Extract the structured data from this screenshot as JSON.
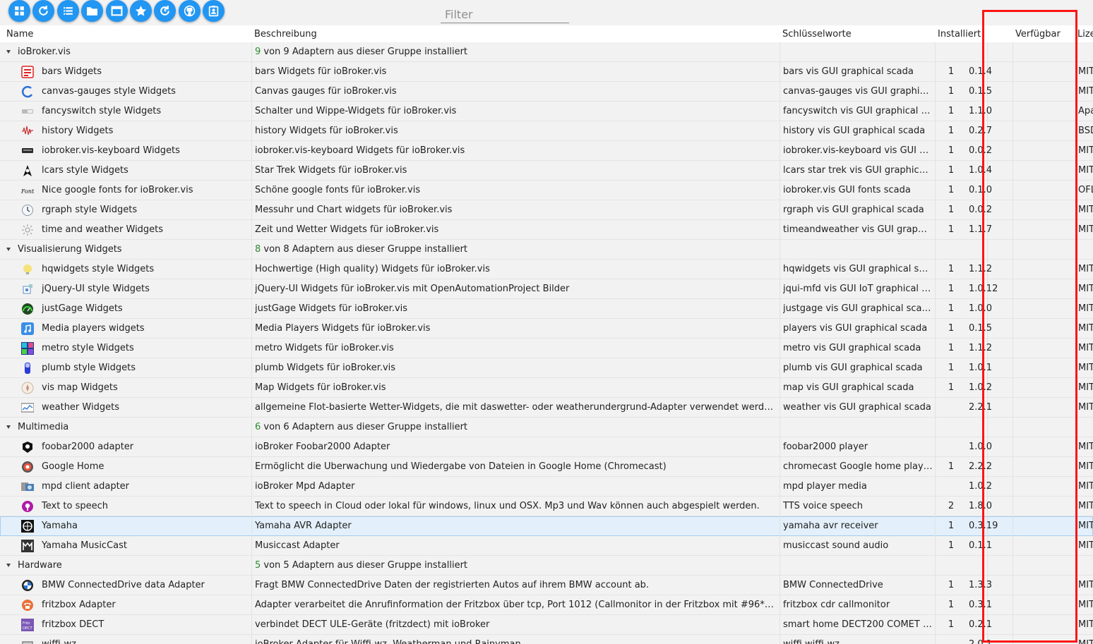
{
  "toolbar": {
    "buttons": [
      {
        "name": "view-tiles-button",
        "icon": "grid-icon"
      },
      {
        "name": "refresh-button",
        "icon": "refresh-icon"
      },
      {
        "name": "list-view-button",
        "icon": "list-icon"
      },
      {
        "name": "folder-button",
        "icon": "folder-icon"
      },
      {
        "name": "window-button",
        "icon": "window-icon"
      },
      {
        "name": "favorites-button",
        "icon": "star-icon"
      },
      {
        "name": "update-button",
        "icon": "update-icon"
      },
      {
        "name": "github-button",
        "icon": "github-icon"
      },
      {
        "name": "contacts-button",
        "icon": "badge-icon"
      }
    ],
    "filter_placeholder": "Filter"
  },
  "columns": {
    "name": "Name",
    "description": "Beschreibung",
    "keywords": "Schlüsselworte",
    "installed": "Installiert",
    "available": "Verfügbar",
    "license": "Lize"
  },
  "colors": {
    "accent": "#2196f3",
    "highlight": "#ff1414",
    "group_count": "#2e8b2e"
  },
  "rows": [
    {
      "type": "group",
      "name": "ioBroker.vis",
      "count": "9",
      "desc_rest": " von 9 Adaptern aus dieser Gruppe installiert"
    },
    {
      "type": "item",
      "icon": "bars-icon",
      "name": "bars Widgets",
      "desc": "bars Widgets für ioBroker.vis",
      "keywords": "bars vis GUI graphical scada",
      "installed": "1",
      "version": "0.1.4",
      "license": "MIT"
    },
    {
      "type": "item",
      "icon": "gauge-icon",
      "name": "canvas-gauges style Widgets",
      "desc": "Canvas gauges für ioBroker.vis",
      "keywords": "canvas-gauges vis GUI graphica...",
      "installed": "1",
      "version": "0.1.5",
      "license": "MIT"
    },
    {
      "type": "item",
      "icon": "switch-icon",
      "name": "fancyswitch style Widgets",
      "desc": "Schalter und Wippe-Widgets für ioBroker.vis",
      "keywords": "fancyswitch vis GUI graphical sc...",
      "installed": "1",
      "version": "1.1.0",
      "license": "Apa"
    },
    {
      "type": "item",
      "icon": "waveform-icon",
      "name": "history Widgets",
      "desc": "history Widgets für ioBroker.vis",
      "keywords": "history vis GUI graphical scada",
      "installed": "1",
      "version": "0.2.7",
      "license": "BSD"
    },
    {
      "type": "item",
      "icon": "keyboard-icon",
      "name": "iobroker.vis-keyboard Widgets",
      "desc": "iobroker.vis-keyboard Widgets für ioBroker.vis",
      "keywords": "iobroker.vis-keyboard vis GUI g...",
      "installed": "1",
      "version": "0.0.2",
      "license": "MIT"
    },
    {
      "type": "item",
      "icon": "starfleet-icon",
      "name": "lcars style Widgets",
      "desc": "Star Trek Widgets für ioBroker.vis",
      "keywords": "lcars star trek vis GUI graphical ...",
      "installed": "1",
      "version": "1.0.4",
      "license": "MIT"
    },
    {
      "type": "item",
      "icon": "fonts-icon",
      "name": "Nice google fonts for ioBroker.vis",
      "desc": "Schöne google fonts für ioBroker.vis",
      "keywords": "iobroker.vis GUI fonts scada",
      "installed": "1",
      "version": "0.1.0",
      "license": "OFL"
    },
    {
      "type": "item",
      "icon": "clock-icon",
      "name": "rgraph style Widgets",
      "desc": "Messuhr und Chart widgets für ioBroker.vis",
      "keywords": "rgraph vis GUI graphical scada",
      "installed": "1",
      "version": "0.0.2",
      "license": "MIT"
    },
    {
      "type": "item",
      "icon": "sun-icon",
      "name": "time and weather Widgets",
      "desc": "Zeit und Wetter Widgets für ioBroker.vis",
      "keywords": "timeandweather vis GUI graphi...",
      "installed": "1",
      "version": "1.1.7",
      "license": "MIT"
    },
    {
      "type": "group",
      "name": "Visualisierung Widgets",
      "count": "8",
      "desc_rest": " von 8 Adaptern aus dieser Gruppe installiert"
    },
    {
      "type": "item",
      "icon": "bulb-icon",
      "name": "hqwidgets style Widgets",
      "desc": "Hochwertige (High quality) Widgets für ioBroker.vis",
      "keywords": "hqwidgets vis GUI graphical sca...",
      "installed": "1",
      "version": "1.1.2",
      "license": "MIT"
    },
    {
      "type": "item",
      "icon": "jquery-icon",
      "name": "jQuery-UI style Widgets",
      "desc": "jQuery-UI Widgets für ioBroker.vis mit OpenAutomationProject Bilder",
      "keywords": "jqui-mfd vis GUI IoT graphical s...",
      "installed": "1",
      "version": "1.0.12",
      "license": "MIT"
    },
    {
      "type": "item",
      "icon": "speedometer-icon",
      "name": "justGage Widgets",
      "desc": "justGage Widgets für ioBroker.vis",
      "keywords": "justgage vis GUI graphical scada",
      "installed": "1",
      "version": "1.0.0",
      "license": "MIT"
    },
    {
      "type": "item",
      "icon": "music-note-icon",
      "name": "Media players widgets",
      "desc": "Media Players Widgets für ioBroker.vis",
      "keywords": "players vis GUI graphical scada",
      "installed": "1",
      "version": "0.1.5",
      "license": "MIT"
    },
    {
      "type": "item",
      "icon": "metro-tiles-icon",
      "name": "metro style Widgets",
      "desc": "metro Widgets für ioBroker.vis",
      "keywords": "metro vis GUI graphical scada",
      "installed": "1",
      "version": "1.1.2",
      "license": "MIT"
    },
    {
      "type": "item",
      "icon": "battery-icon",
      "name": "plumb style Widgets",
      "desc": "plumb Widgets für ioBroker.vis",
      "keywords": "plumb vis GUI graphical scada",
      "installed": "1",
      "version": "1.0.1",
      "license": "MIT"
    },
    {
      "type": "item",
      "icon": "map-icon",
      "name": "vis map Widgets",
      "desc": "Map Widgets für ioBroker.vis",
      "keywords": "map vis GUI graphical scada",
      "installed": "1",
      "version": "1.0.2",
      "license": "MIT"
    },
    {
      "type": "item",
      "icon": "chart-icon",
      "name": "weather Widgets",
      "desc": "allgemeine Flot-basierte Wetter-Widgets, die mit daswetter- oder weatherundergrund-Adapter verwendet werden ...",
      "keywords": "weather vis GUI graphical scada",
      "installed": "",
      "version": "2.2.1",
      "license": "MIT"
    },
    {
      "type": "group",
      "name": "Multimedia",
      "count": "6",
      "desc_rest": " von 6 Adaptern aus dieser Gruppe installiert"
    },
    {
      "type": "item",
      "icon": "foobar-icon",
      "name": "foobar2000 adapter",
      "desc": "ioBroker Foobar2000 Adapter",
      "keywords": "foobar2000 player",
      "installed": "",
      "version": "1.0.0",
      "license": "MIT"
    },
    {
      "type": "item",
      "icon": "google-home-icon",
      "name": "Google Home",
      "desc": "Ermöglicht die Überwachung und Wiedergabe von Dateien in Google Home (Chromecast)",
      "keywords": "chromecast Google home playe...",
      "installed": "1",
      "version": "2.2.2",
      "license": "MIT"
    },
    {
      "type": "item",
      "icon": "mpd-icon",
      "name": "mpd client adapter",
      "desc": "ioBroker Mpd Adapter",
      "keywords": "mpd player media",
      "installed": "",
      "version": "1.0.2",
      "license": "MIT"
    },
    {
      "type": "item",
      "icon": "speech-icon",
      "name": "Text to speech",
      "desc": "Text to speech in Cloud oder lokal für windows, linux und OSX. Mp3 und Wav können auch abgespielt werden.",
      "keywords": "TTS voice speech",
      "installed": "2",
      "version": "1.8.0",
      "license": "MIT"
    },
    {
      "type": "item",
      "icon": "yamaha-icon",
      "name": "Yamaha",
      "desc": "Yamaha AVR Adapter",
      "keywords": "yamaha avr receiver",
      "installed": "1",
      "version": "0.3.19",
      "license": "MIT",
      "selected": true
    },
    {
      "type": "item",
      "icon": "musiccast-icon",
      "name": "Yamaha MusicCast",
      "desc": "Musiccast Adapter",
      "keywords": "musiccast sound audio",
      "installed": "1",
      "version": "0.1.1",
      "license": "MIT"
    },
    {
      "type": "group",
      "name": "Hardware",
      "count": "5",
      "desc_rest": " von 5 Adaptern aus dieser Gruppe installiert"
    },
    {
      "type": "item",
      "icon": "bmw-icon",
      "name": "BMW ConnectedDrive data Adapter",
      "desc": "Fragt BMW ConnectedDrive Daten der registrierten Autos auf ihrem BMW account ab.",
      "keywords": "BMW ConnectedDrive",
      "installed": "1",
      "version": "1.3.3",
      "license": "MIT"
    },
    {
      "type": "item",
      "icon": "phone-icon",
      "name": "fritzbox Adapter",
      "desc": "Adapter verarbeitet die Anrufinformation der Fritzbox über tcp, Port 1012 (Callmonitor in der Fritzbox mit #96*5* a...",
      "keywords": "fritzbox cdr callmonitor",
      "installed": "1",
      "version": "0.3.1",
      "license": "MIT"
    },
    {
      "type": "item",
      "icon": "dect-icon",
      "name": "fritzbox DECT",
      "desc": "verbindet DECT ULE-Geräte (fritzdect) mit ioBroker",
      "keywords": "smart home DECT200 COMET fr...",
      "installed": "1",
      "version": "0.2.1",
      "license": "MIT"
    },
    {
      "type": "item",
      "icon": "wiffi-icon",
      "name": "wiffi-wz",
      "desc": "ioBroker Adapter für Wiffi-wz, Weatherman und Rainyman",
      "keywords": "wiffi wiffi-wz",
      "installed": "",
      "version": "2.0.1",
      "license": "MIT"
    }
  ]
}
